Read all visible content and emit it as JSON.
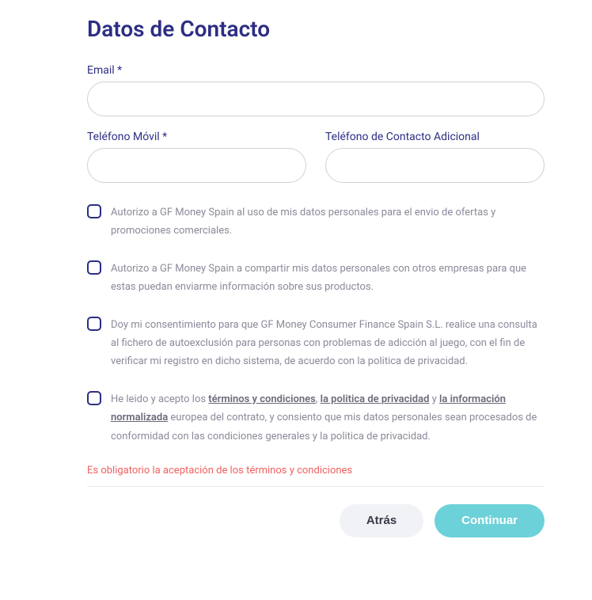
{
  "title": "Datos de Contacto",
  "fields": {
    "email": {
      "label": "Email",
      "required": "*",
      "value": ""
    },
    "mobile": {
      "label": "Teléfono Móvil",
      "required": "*",
      "value": ""
    },
    "additional": {
      "label": "Teléfono de Contacto Adicional",
      "required": "",
      "value": ""
    }
  },
  "checkboxes": {
    "marketing": "Autorizo a GF Money Spain al uso de mis datos personales para el envio de ofertas y promociones comerciales.",
    "sharing": "Autorizo a GF Money Spain a compartir mis datos personales con otros empresas para que estas puedan enviarme información sobre sus productos.",
    "consent": "Doy mi consentimiento para que GF Money Consumer Finance Spain S.L. realice una consulta al fichero de autoexclusión para personas con problemas de adicción al juego, con el fin de verificar mi registro en dicho sistema, de acuerdo con la politica de privacidad.",
    "terms": {
      "prefix": "He leido y acepto los ",
      "link1": "términos y condiciones",
      "sep1": ", ",
      "link2": "la politica de privacidad",
      "sep2": " y ",
      "link3": "la información normalizada",
      "suffix": " europea del contrato, y consiento que mis datos personales sean procesados de conformidad con las condiciones generales y la politica de privacidad."
    }
  },
  "error": "Es obligatorio la aceptación de los términos y condiciones",
  "buttons": {
    "back": "Atrás",
    "continue": "Continuar"
  }
}
